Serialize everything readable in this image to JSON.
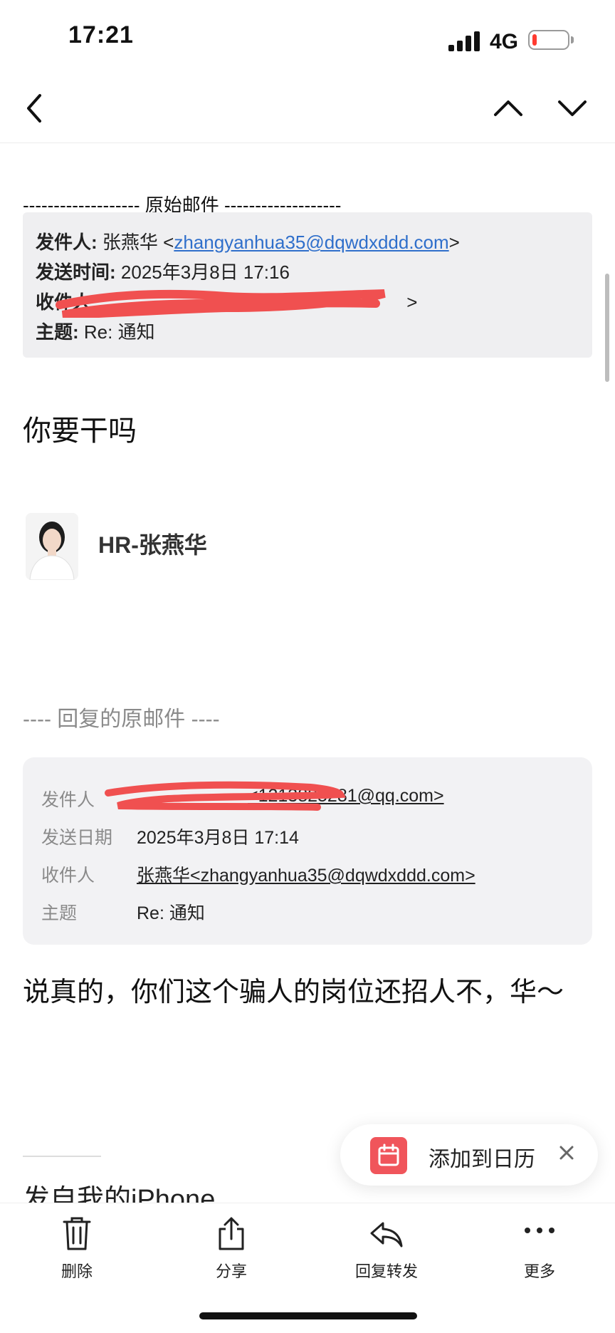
{
  "status_bar": {
    "time": "17:21",
    "network": "4G",
    "battery_level": 0.12
  },
  "nav": {
    "back_icon": "chevron-left-icon",
    "prev_icon": "chevron-up-icon",
    "next_icon": "chevron-down-icon"
  },
  "original_mail": {
    "separator": "------------------- 原始邮件 -------------------",
    "from_label": "发件人:",
    "from_name": "张燕华 <",
    "from_email": "zhangyanhua35@dqwdxddd.com",
    "from_close": ">",
    "sent_label": "发送时间:",
    "sent_value": "2025年3月8日 17:16",
    "to_label": "收件人",
    "to_close": ">",
    "subject_label": "主题:",
    "subject_value": "Re: 通知"
  },
  "body_text": "你要干吗",
  "signature": {
    "name": "HR-张燕华"
  },
  "reply_section": {
    "separator": "---- 回复的原邮件 ----",
    "from_label": "发件人",
    "from_value": "<1213825281@qq.com>",
    "date_label": "发送日期",
    "date_value": "2025年3月8日 17:14",
    "to_label": "收件人",
    "to_value": "张燕华<zhangyanhua35@dqwdxddd.com>",
    "subject_label": "主题",
    "subject_value": "Re: 通知"
  },
  "reply_body": "说真的，你们这个骗人的岗位还招人不，华～",
  "footer": {
    "sent_from": "发自我的iPhone"
  },
  "toast": {
    "label": "添加到日历",
    "icon": "calendar-icon",
    "accent": "#f0555b"
  },
  "toolbar": {
    "delete_label": "删除",
    "share_label": "分享",
    "reply_label": "回复转发",
    "more_label": "更多"
  },
  "colors": {
    "link": "#2f6fcb",
    "box_bg": "#efeff1",
    "redaction": "#f05050"
  }
}
